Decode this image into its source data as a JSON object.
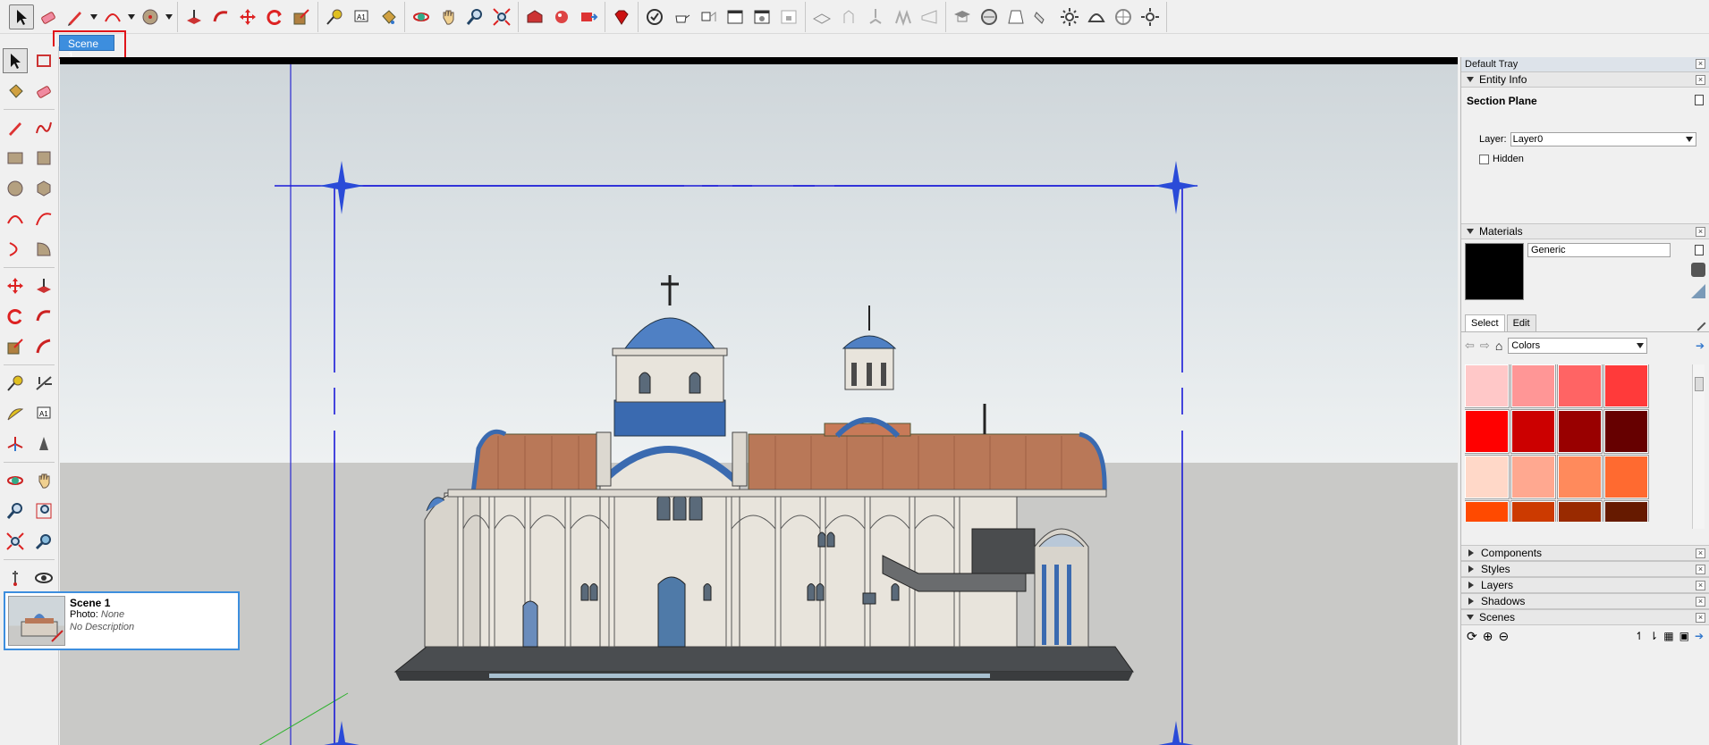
{
  "toolbar": {
    "icons": [
      "select-arrow-icon",
      "eraser-icon",
      "pencil-icon",
      "arc-icon",
      "circle-icon",
      "push-pull-icon",
      "follow-me-icon",
      "move-icon",
      "rotate-icon",
      "scale-icon",
      "tape-measure-icon",
      "text-icon",
      "paint-bucket-icon",
      "orbit-icon",
      "pan-hand-icon",
      "zoom-icon",
      "zoom-extents-icon",
      "warehouse-icon",
      "share-model-icon",
      "extension-icon",
      "ruby-icon",
      "sandbox-icon",
      "section-plane-icon",
      "section-cut-icon",
      "fog-icon",
      "shadows-icon",
      "styles-icon",
      "camera-icon",
      "position-camera-icon",
      "look-around-icon",
      "walk-icon",
      "sun-icon",
      "globe-icon",
      "grid-icon"
    ]
  },
  "scene_tab": {
    "label": "Scene 1"
  },
  "tray": {
    "title": "Default Tray",
    "entity_info": {
      "header": "Entity Info",
      "type": "Section Plane",
      "layer_label": "Layer:",
      "layer_value": "Layer0",
      "hidden_label": "Hidden"
    },
    "materials": {
      "header": "Materials",
      "name": "Generic",
      "tab_select": "Select",
      "tab_edit": "Edit",
      "library": "Colors",
      "swatches": [
        "#ffc8c8",
        "#ff9696",
        "#ff6464",
        "#ff3a3a",
        "#ff0000",
        "#cc0000",
        "#990000",
        "#660000",
        "#ffd8c8",
        "#ffa890",
        "#ff8a5c",
        "#ff6a30",
        "#ff4a00",
        "#cc3a00",
        "#992a00",
        "#661a00"
      ]
    },
    "collapsed_panels": [
      "Components",
      "Styles",
      "Layers",
      "Shadows"
    ],
    "scenes": {
      "header": "Scenes",
      "item_name": "Scene 1",
      "photo_label": "Photo:",
      "photo_value": "None",
      "description": "No Description"
    }
  }
}
